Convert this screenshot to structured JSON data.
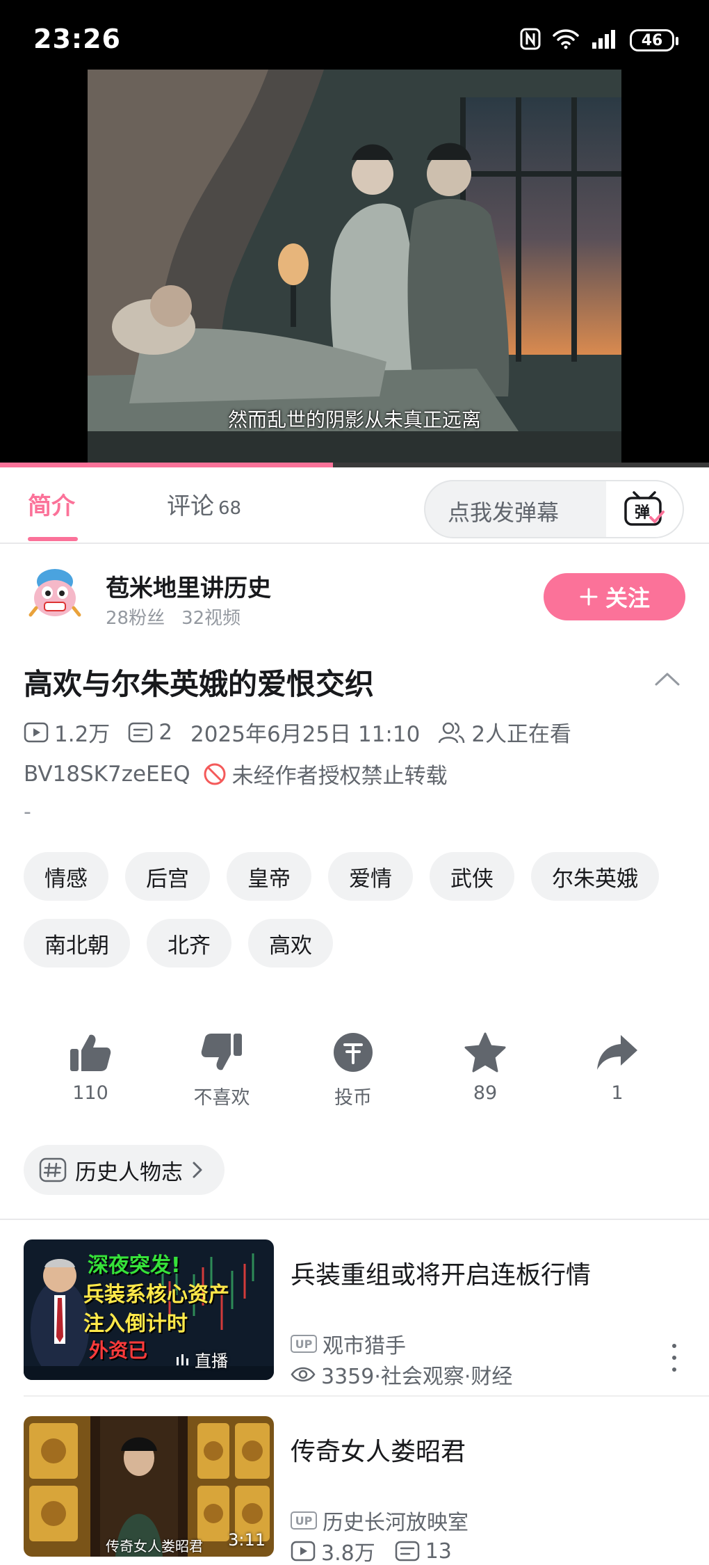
{
  "status_bar": {
    "time": "23:26",
    "battery": "46",
    "icons": [
      "nfc-icon",
      "wifi-icon",
      "signal-icon",
      "battery-icon"
    ]
  },
  "video": {
    "subtitle": "然而乱世的阴影从未真正远离",
    "progress": 0.47
  },
  "tabs": {
    "intro_label": "简介",
    "comments_label": "评论",
    "comments_count": "68",
    "danmaku_placeholder": "点我发弹幕",
    "danmaku_button": "弹"
  },
  "uploader": {
    "name": "苞米地里讲历史",
    "fans": "28粉丝",
    "videos": "32视频",
    "follow_label": "关注"
  },
  "video_info": {
    "title": "高欢与尔朱英娥的爱恨交织",
    "views": "1.2万",
    "danmaku_count": "2",
    "date": "2025年6月25日 11:10",
    "watching": "2人正在看",
    "bvid": "BV18SK7zeEEQ",
    "copyright": "未经作者授权禁止转载",
    "description": "-"
  },
  "tags": [
    "情感",
    "后宫",
    "皇帝",
    "爱情",
    "武侠",
    "尔朱英娥",
    "南北朝",
    "北齐",
    "高欢"
  ],
  "actions": {
    "like": "110",
    "dislike": "不喜欢",
    "coin": "投币",
    "favorite": "89",
    "share": "1"
  },
  "series": {
    "label": "历史人物志"
  },
  "recommendations": [
    {
      "title": "兵装重组或将开启连板行情",
      "author": "观市猎手",
      "stats": "3359·社会观察·财经",
      "badge": "直播",
      "thumb_text_1": "深夜突发!",
      "thumb_text_2": "兵装系核心资产",
      "thumb_text_3": "注入倒计时",
      "thumb_text_4": "外资已"
    },
    {
      "title": "传奇女人娄昭君",
      "author": "历史长河放映室",
      "views": "3.8万",
      "danmaku": "13",
      "duration": "3:11",
      "thumb_caption": "传奇女人娄昭君"
    }
  ],
  "colors": {
    "accent": "#fb7299",
    "text_primary": "#18191c",
    "text_secondary": "#61666d",
    "chip_bg": "#f1f2f3"
  }
}
